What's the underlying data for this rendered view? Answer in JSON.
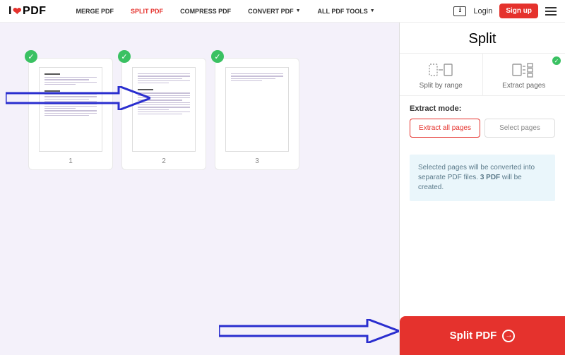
{
  "header": {
    "logo_pre": "I",
    "logo_post": "PDF",
    "nav": [
      {
        "label": "MERGE PDF",
        "active": false,
        "dropdown": false
      },
      {
        "label": "SPLIT PDF",
        "active": true,
        "dropdown": false
      },
      {
        "label": "COMPRESS PDF",
        "active": false,
        "dropdown": false
      },
      {
        "label": "CONVERT PDF",
        "active": false,
        "dropdown": true
      },
      {
        "label": "ALL PDF TOOLS",
        "active": false,
        "dropdown": true
      }
    ],
    "login": "Login",
    "signup": "Sign up"
  },
  "thumbs": {
    "pages": [
      "1",
      "2",
      "3"
    ]
  },
  "sidebar": {
    "title": "Split",
    "modes": {
      "range": "Split by range",
      "extract": "Extract pages"
    },
    "extract_label": "Extract mode:",
    "options": {
      "extract_all": "Extract all pages",
      "select_pages": "Select pages"
    },
    "info_pre": "Selected pages will be converted into separate PDF files. ",
    "info_bold": "3 PDF",
    "info_post": " will be created.",
    "cta": "Split PDF"
  }
}
